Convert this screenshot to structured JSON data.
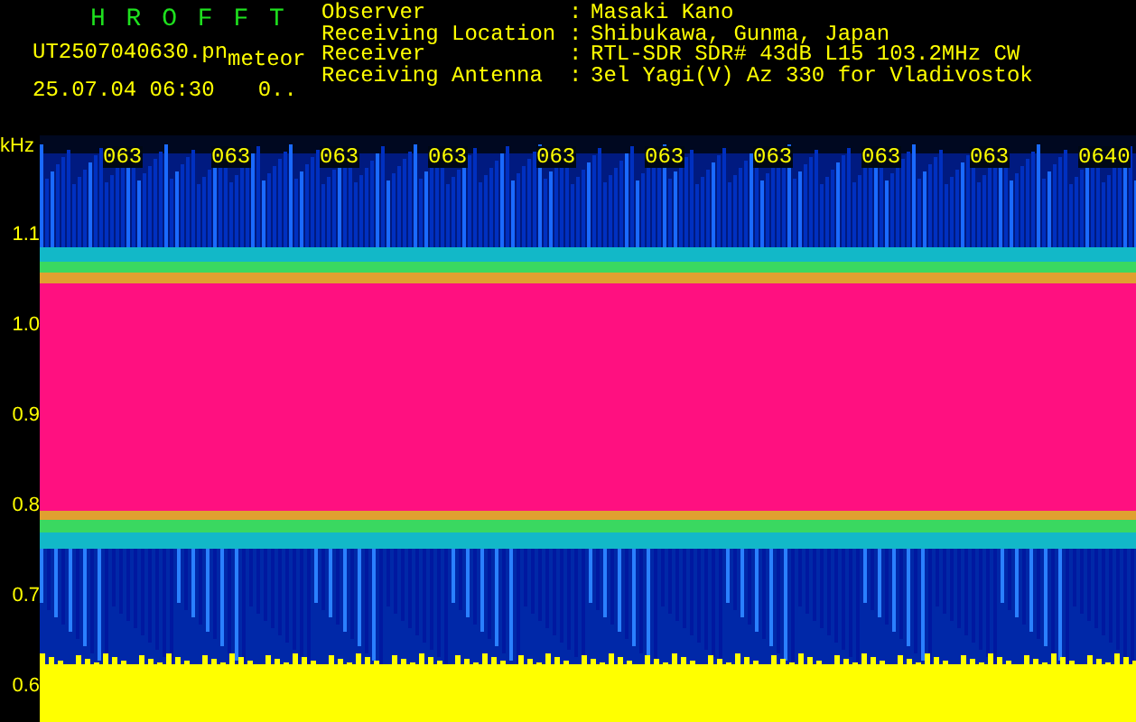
{
  "header": {
    "title": "H R O F F T",
    "filename": "UT2507040630.pn",
    "type_label": "meteor",
    "datetime": "25.07.04 06:30",
    "count": "0..",
    "info": [
      {
        "label": "Observer",
        "separator": ":",
        "value": "Masaki Kano"
      },
      {
        "label": "Receiving Location",
        "separator": ":",
        "value": "Shibukawa, Gunma, Japan"
      },
      {
        "label": "Receiver",
        "separator": ":",
        "value": "RTL-SDR SDR# 43dB L15 103.2MHz CW"
      },
      {
        "label": "Receiving Antenna",
        "separator": ":",
        "value": "3el Yagi(V) Az 330 for Vladivostok"
      }
    ]
  },
  "spectrogram": {
    "unit": "kHz",
    "y_ticks": [
      "1.1",
      "1.0",
      "0.9",
      "0.8",
      "0.7",
      "0.6"
    ],
    "time_labels": [
      "063",
      "063",
      "063",
      "063",
      "063",
      "063",
      "063",
      "063",
      "063",
      "0640"
    ]
  }
}
